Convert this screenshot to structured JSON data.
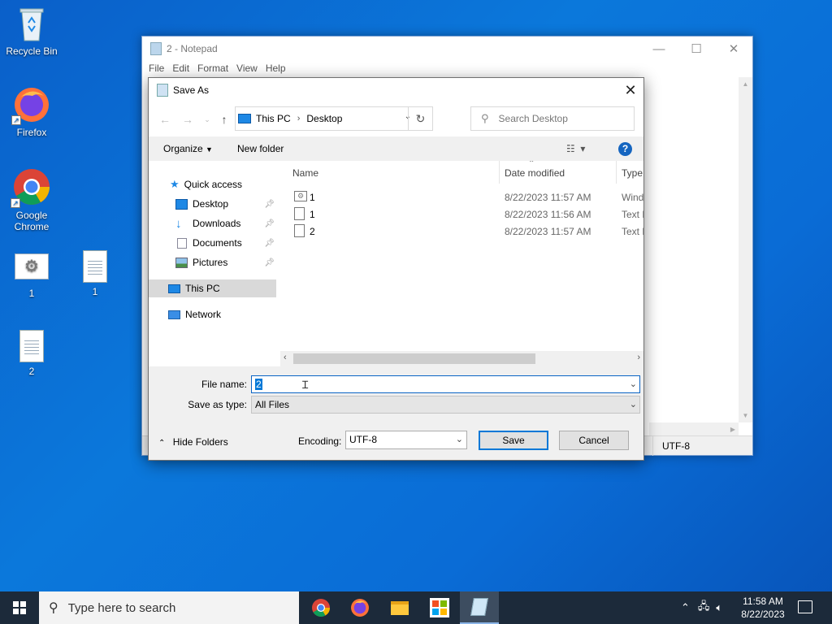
{
  "desktop": {
    "icons": [
      {
        "label": "Recycle Bin",
        "icon": "recycle-bin-icon"
      },
      {
        "label": "Firefox",
        "icon": "firefox-icon"
      },
      {
        "label": "Google Chrome",
        "icon": "chrome-icon"
      },
      {
        "label": "1",
        "icon": "settings-file-icon"
      },
      {
        "label": "1",
        "icon": "text-file-icon"
      },
      {
        "label": "2",
        "icon": "text-file-icon"
      }
    ]
  },
  "notepad": {
    "title": "2 - Notepad",
    "menu": [
      "File",
      "Edit",
      "Format",
      "View",
      "Help"
    ],
    "status_encoding": "UTF-8"
  },
  "dialog": {
    "title": "Save As",
    "address": {
      "root": "This PC",
      "current": "Desktop"
    },
    "search_placeholder": "Search Desktop",
    "toolbar": {
      "organize": "Organize",
      "new_folder": "New folder"
    },
    "nav": {
      "quick_access": "Quick access",
      "items": [
        {
          "label": "Desktop",
          "icon": "desktop-folder-icon"
        },
        {
          "label": "Downloads",
          "icon": "downloads-folder-icon"
        },
        {
          "label": "Documents",
          "icon": "documents-folder-icon"
        },
        {
          "label": "Pictures",
          "icon": "pictures-folder-icon"
        }
      ],
      "this_pc": "This PC",
      "network": "Network"
    },
    "columns": {
      "name": "Name",
      "date": "Date modified",
      "type": "Type"
    },
    "files": [
      {
        "name": "1",
        "date": "8/22/2023 11:57 AM",
        "type": "Windo"
      },
      {
        "name": "1",
        "date": "8/22/2023 11:56 AM",
        "type": "Text D"
      },
      {
        "name": "2",
        "date": "8/22/2023 11:57 AM",
        "type": "Text D"
      }
    ],
    "file_name_label": "File name:",
    "file_name_value": "2",
    "save_type_label": "Save as type:",
    "save_type_value": "All Files",
    "hide_folders": "Hide Folders",
    "encoding_label": "Encoding:",
    "encoding_value": "UTF-8",
    "save_button": "Save",
    "cancel_button": "Cancel"
  },
  "taskbar": {
    "search_placeholder": "Type here to search",
    "time": "11:58 AM",
    "date": "8/22/2023"
  },
  "colors": {
    "accent": "#0078d7",
    "desktop": "#0a6cd6",
    "taskbar": "#1c2a3a"
  }
}
